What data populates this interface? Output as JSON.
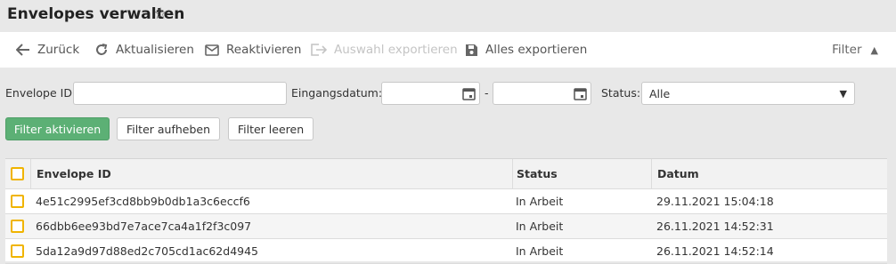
{
  "header": {
    "title": "Envelopes verwalten"
  },
  "toolbar": {
    "back": "Zurück",
    "refresh": "Aktualisieren",
    "reactivate": "Reaktivieren",
    "export_selection": "Auswahl exportieren",
    "export_all": "Alles exportieren",
    "filter": "Filter"
  },
  "filters": {
    "envelope_id_label": "Envelope ID",
    "envelope_id_value": "",
    "date_label": "Eingangsdatum:",
    "date_separator": "-",
    "status_label": "Status:",
    "status_value": "Alle",
    "activate": "Filter aktivieren",
    "remove": "Filter aufheben",
    "clear": "Filter leeren"
  },
  "table": {
    "columns": [
      "Envelope ID",
      "Status",
      "Datum"
    ],
    "rows": [
      {
        "id": "4e51c2995ef3cd8bb9b0db1a3c6eccf6",
        "status": "In Arbeit",
        "date": "29.11.2021 15:04:18"
      },
      {
        "id": "66dbb6ee93bd7e7ace7ca4a1f2f3c097",
        "status": "In Arbeit",
        "date": "26.11.2021 14:52:31"
      },
      {
        "id": "5da12a9d97d88ed2c705cd1ac62d4945",
        "status": "In Arbeit",
        "date": "26.11.2021 14:52:14"
      }
    ]
  },
  "colors": {
    "primary_button": "#5cb075",
    "checkbox_border": "#f0b400",
    "disabled_text": "#c4c4c4"
  }
}
